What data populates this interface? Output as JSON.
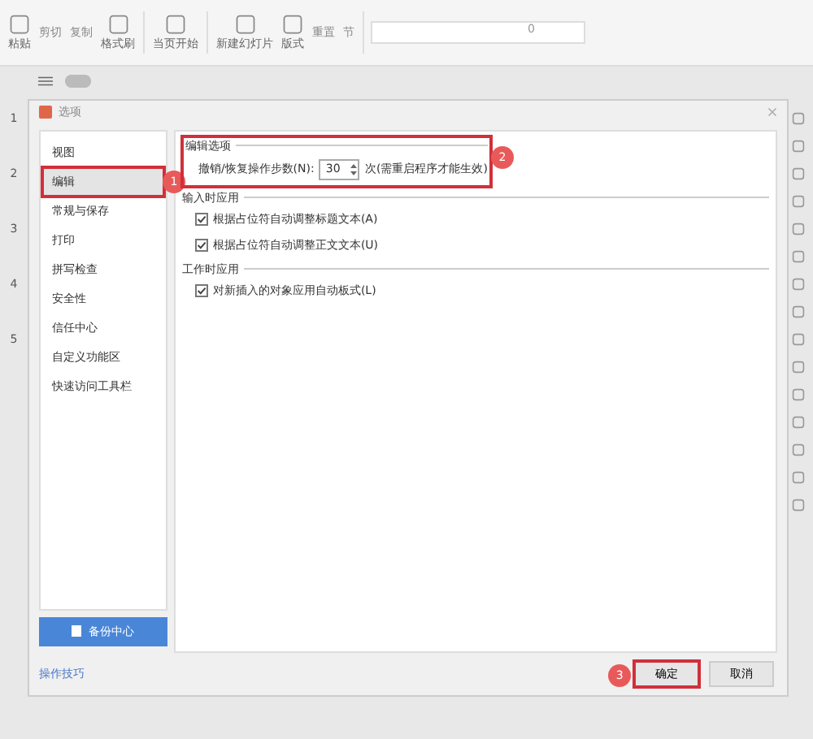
{
  "toolbar": {
    "groups": [
      {
        "items": [
          {
            "label": "粘贴",
            "kind": "big"
          },
          {
            "label": "剪切",
            "kind": "small"
          },
          {
            "label": "复制",
            "kind": "small"
          },
          {
            "label": "格式刷",
            "kind": "big"
          }
        ]
      },
      {
        "items": [
          {
            "label": "当页开始",
            "kind": "big"
          }
        ]
      },
      {
        "items": [
          {
            "label": "新建幻灯片",
            "kind": "big"
          },
          {
            "label": "版式",
            "kind": "big"
          },
          {
            "label": "重置",
            "kind": "small"
          },
          {
            "label": "节",
            "kind": "small"
          }
        ]
      }
    ],
    "font_size": "0"
  },
  "slide_numbers": [
    "1",
    "2",
    "3",
    "4",
    "5"
  ],
  "dialog": {
    "title": "选项",
    "sidebar": [
      {
        "label": "视图",
        "selected": false
      },
      {
        "label": "编辑",
        "selected": true,
        "annotation": "1"
      },
      {
        "label": "常规与保存",
        "selected": false
      },
      {
        "label": "打印",
        "selected": false
      },
      {
        "label": "拼写检查",
        "selected": false
      },
      {
        "label": "安全性",
        "selected": false
      },
      {
        "label": "信任中心",
        "selected": false
      },
      {
        "label": "自定义功能区",
        "selected": false
      },
      {
        "label": "快速访问工具栏",
        "selected": false
      }
    ],
    "backup_button": "备份中心",
    "tips_link": "操作技巧",
    "sections": [
      {
        "title": "编辑选项",
        "annotation": "2",
        "rows": [
          {
            "kind": "spin",
            "label": "撤销/恢复操作步数(N):",
            "value": "30",
            "suffix": "次(需重启程序才能生效)"
          }
        ]
      },
      {
        "title": "输入时应用",
        "rows": [
          {
            "kind": "check",
            "label": "根据占位符自动调整标题文本(A)",
            "checked": true
          },
          {
            "kind": "check",
            "label": "根据占位符自动调整正文文本(U)",
            "checked": true
          }
        ]
      },
      {
        "title": "工作时应用",
        "rows": [
          {
            "kind": "check",
            "label": "对新插入的对象应用自动板式(L)",
            "checked": true
          }
        ]
      }
    ],
    "buttons": [
      {
        "label": "确定",
        "annotation": "3"
      },
      {
        "label": "取消"
      }
    ]
  }
}
